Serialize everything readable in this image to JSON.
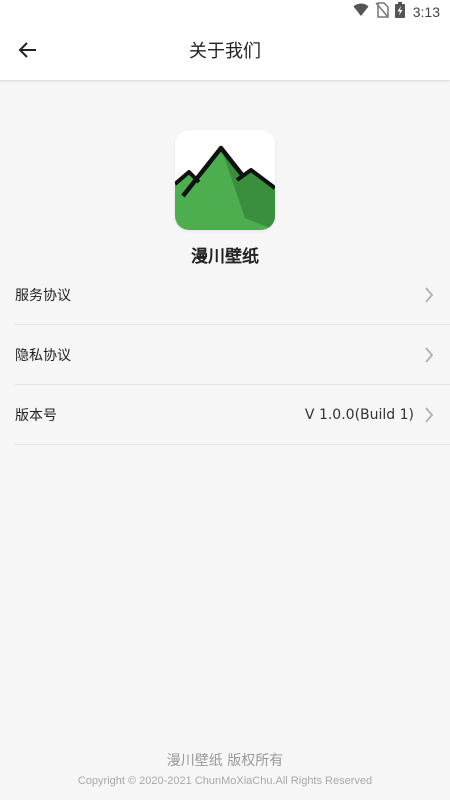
{
  "status_bar": {
    "time": "3:13",
    "icons": [
      "wifi-icon",
      "no-sim-icon",
      "battery-charging-icon"
    ]
  },
  "header": {
    "title": "关于我们",
    "back_icon": "arrow-left-icon"
  },
  "app": {
    "name": "漫川壁纸",
    "logo_icon": "mountain-logo-icon",
    "logo_colors": {
      "green": "#4cae4f",
      "dark_green": "#3a8f3e",
      "outline": "#111111"
    }
  },
  "settings": {
    "items": [
      {
        "label": "服务协议",
        "value": ""
      },
      {
        "label": "隐私协议",
        "value": ""
      },
      {
        "label": "版本号",
        "value": "V 1.0.0(Build 1)"
      }
    ]
  },
  "footer": {
    "brand": "漫川壁纸 版权所有",
    "copyright": "Copyright © 2020-2021 ChunMoXiaChu.All Rights Reserved"
  }
}
